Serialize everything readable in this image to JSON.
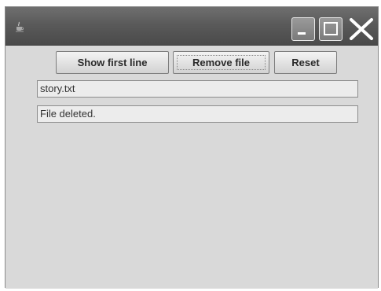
{
  "window": {
    "title": "",
    "icon": "java-cup-icon",
    "controls": [
      "minimize-icon",
      "maximize-icon",
      "close-icon"
    ]
  },
  "toolbar": {
    "show_first_line_label": "Show first line",
    "remove_file_label": "Remove file",
    "reset_label": "Reset"
  },
  "fields": {
    "filename_value": "story.txt",
    "status_value": "File deleted."
  },
  "colors": {
    "titlebar": "#5a5a5a",
    "panel": "#d9d9d9"
  }
}
